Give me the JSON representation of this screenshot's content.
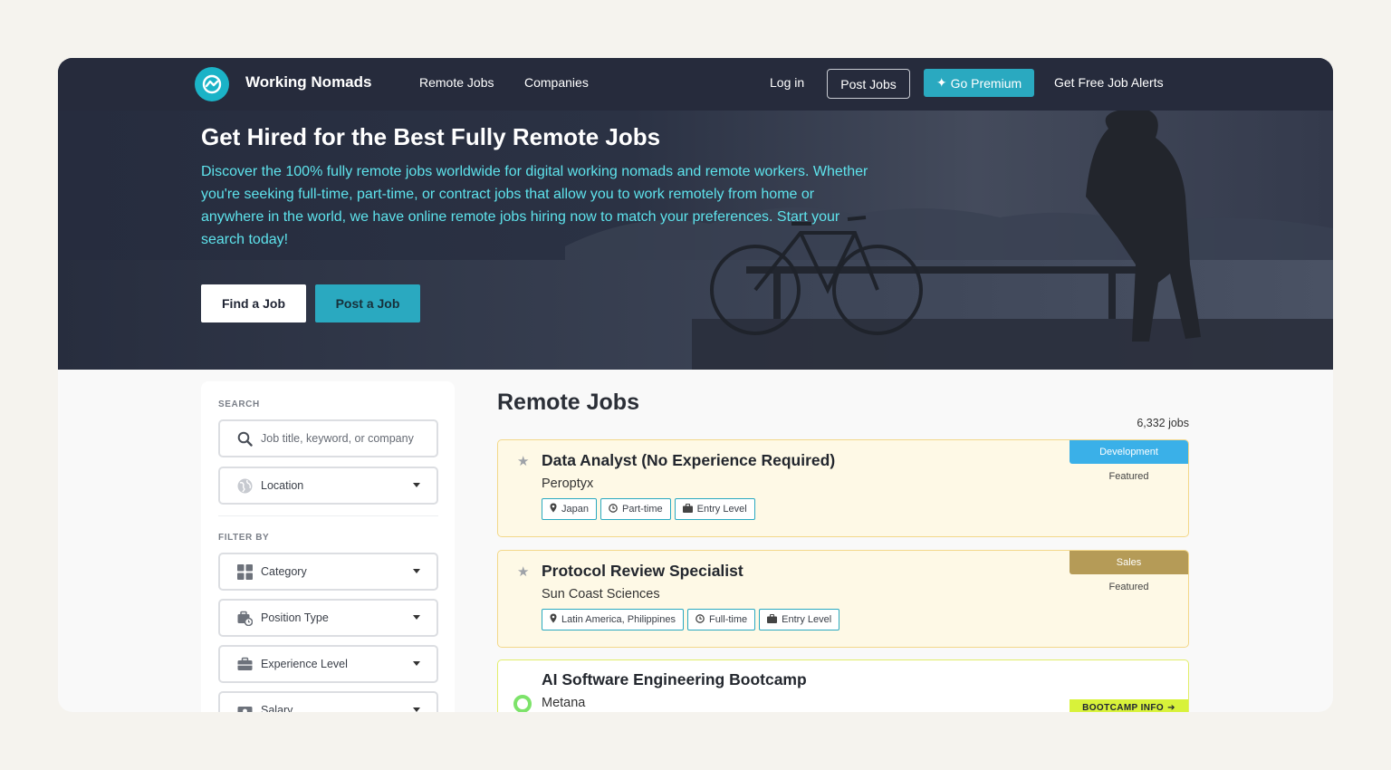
{
  "nav": {
    "brand": "Working Nomads",
    "links": [
      "Remote Jobs",
      "Companies"
    ],
    "login": "Log in",
    "post_jobs": "Post Jobs",
    "premium": "Go Premium",
    "alerts": "Get Free Job Alerts"
  },
  "hero": {
    "title": "Get Hired for the Best Fully Remote Jobs",
    "description": "Discover the 100% fully remote jobs worldwide for digital working nomads and remote workers. Whether you're seeking full-time, part-time, or contract jobs that allow you to work remotely from home or anywhere in the world, we have online remote jobs hiring now to match your preferences. Start your search today!",
    "find_button": "Find a Job",
    "post_button": "Post a Job"
  },
  "sidebar": {
    "search_label": "SEARCH",
    "search_placeholder": "Job title, keyword, or company",
    "location_label": "Location",
    "filter_label": "FILTER BY",
    "filters": [
      "Category",
      "Position Type",
      "Experience Level",
      "Salary"
    ]
  },
  "main": {
    "title": "Remote Jobs",
    "count": "6,332 jobs",
    "jobs": [
      {
        "title": "Data Analyst (No Experience Required)",
        "company": "Peroptyx",
        "location": "Japan",
        "type": "Part-time",
        "level": "Entry Level",
        "category": "Development",
        "category_color": "#3ab0e8",
        "featured": "Featured"
      },
      {
        "title": "Protocol Review Specialist",
        "company": "Sun Coast Sciences",
        "location": "Latin America, Philippines",
        "type": "Full-time",
        "level": "Entry Level",
        "category": "Sales",
        "category_color": "#b59b57",
        "featured": "Featured"
      }
    ],
    "bootcamp": {
      "title": "AI Software Engineering Bootcamp",
      "company": "Metana",
      "badge": "BOOTCAMP INFO"
    }
  }
}
